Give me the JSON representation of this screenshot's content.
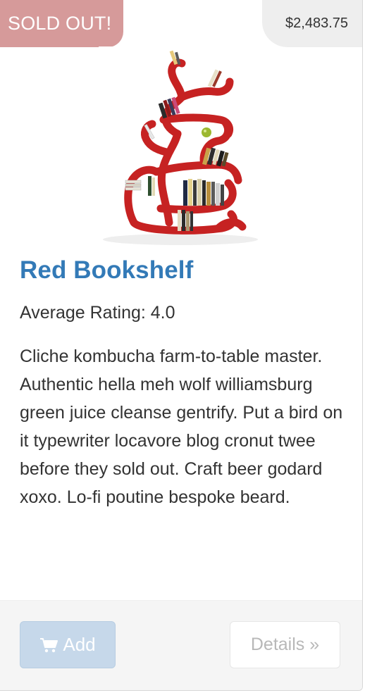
{
  "product": {
    "badge_status": "SOLD OUT!",
    "price": "$2,483.75",
    "title": "Red Bookshelf",
    "rating_text": "Average Rating: 4.0",
    "description": "Cliche kombucha farm-to-table master. Authentic hella meh wolf williamsburg green juice cleanse gentrify. Put a bird on it typewriter locavore blog cronut twee before they sold out. Craft beer godard xoxo. Lo-fi poutine bespoke beard.",
    "image_icon": "product-image-red-bookshelf"
  },
  "actions": {
    "add_label": "Add",
    "add_icon": "shopping-cart-icon",
    "details_label": "Details »"
  },
  "colors": {
    "sold_badge_bg": "#d69a9a",
    "price_badge_bg": "#eeeeee",
    "title": "#337ab7",
    "add_button_bg": "#c6d8ea",
    "shelf_red": "#c62222",
    "footer_bg": "#f5f5f5"
  }
}
